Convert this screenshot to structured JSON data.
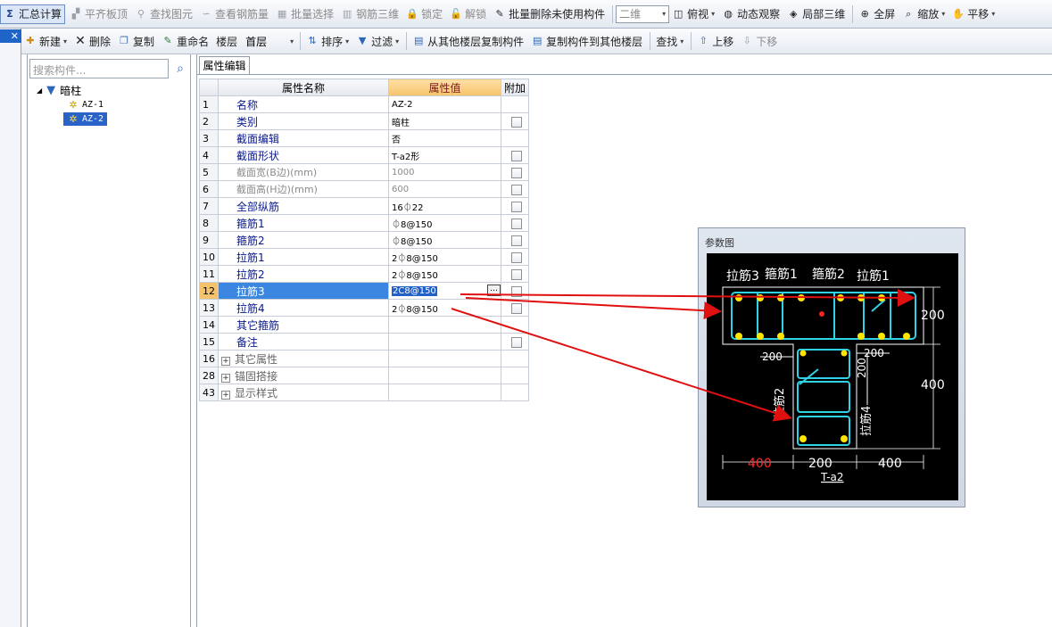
{
  "toolbar1": [
    {
      "id": "summary",
      "label": "汇总计算",
      "icon": "sigma-icon",
      "glyph": "Σ",
      "selected": true,
      "disabled": false
    },
    {
      "id": "flush",
      "label": "平齐板顶",
      "icon": "flush-icon",
      "glyph": "▞",
      "disabled": true
    },
    {
      "id": "find",
      "label": "查找图元",
      "icon": "binoculars-icon",
      "glyph": "⚲",
      "disabled": true
    },
    {
      "id": "rebar",
      "label": "查看钢筋量",
      "icon": "rebar-icon",
      "glyph": "∽",
      "disabled": true
    },
    {
      "id": "batch",
      "label": "批量选择",
      "icon": "batch-select-icon",
      "glyph": "▦",
      "disabled": true
    },
    {
      "id": "r3d",
      "label": "钢筋三维",
      "icon": "rebar-3d-icon",
      "glyph": "▥",
      "disabled": true
    },
    {
      "id": "lock",
      "label": "锁定",
      "icon": "lock-icon",
      "glyph": "🔒",
      "disabled": true
    },
    {
      "id": "unlock",
      "label": "解锁",
      "icon": "unlock-icon",
      "glyph": "🔓",
      "disabled": true
    },
    {
      "id": "batchdel",
      "label": "批量删除未使用构件",
      "icon": "brush-icon",
      "glyph": "✎",
      "disabled": false
    }
  ],
  "toolbar1_right": [
    {
      "id": "top",
      "label": "俯视",
      "icon": "top-view-icon",
      "glyph": "◫",
      "arrow": true
    },
    {
      "id": "orbit",
      "label": "动态观察",
      "icon": "orbit-icon",
      "glyph": "◍",
      "arrow": false
    },
    {
      "id": "local3d",
      "label": "局部三维",
      "icon": "local-3d-icon",
      "glyph": "◈",
      "arrow": false
    },
    {
      "id": "full",
      "label": "全屏",
      "icon": "fullscreen-icon",
      "glyph": "⊕",
      "arrow": false
    },
    {
      "id": "zoom",
      "label": "缩放",
      "icon": "zoom-icon",
      "glyph": "⌕",
      "arrow": true
    },
    {
      "id": "pan",
      "label": "平移",
      "icon": "pan-icon",
      "glyph": "✋",
      "arrow": true
    }
  ],
  "view_combo": "二维",
  "toolbar2": {
    "new": "新建",
    "delete": "删除",
    "copy": "复制",
    "rename": "重命名",
    "floor_label": "楼层",
    "floor_value": "首层",
    "sort": "排序",
    "filter": "过滤",
    "copy_from": "从其他楼层复制构件",
    "copy_to": "复制构件到其他楼层",
    "find": "查找",
    "up": "上移",
    "down": "下移"
  },
  "search_placeholder": "搜索构件...",
  "tree": {
    "root": "暗柱",
    "items": [
      "AZ-1",
      "AZ-2"
    ],
    "selected": 1
  },
  "props": {
    "tab": "属性编辑",
    "headers": {
      "name": "属性名称",
      "value": "属性值",
      "extra": "附加"
    },
    "rows": [
      {
        "n": "1",
        "name": "名称",
        "value": "AZ-2",
        "cb": false,
        "style": "nm"
      },
      {
        "n": "2",
        "name": "类别",
        "value": "暗柱",
        "cb": true,
        "style": "nm"
      },
      {
        "n": "3",
        "name": "截面编辑",
        "value": "否",
        "cb": false,
        "style": "nm"
      },
      {
        "n": "4",
        "name": "截面形状",
        "value": "T-a2形",
        "cb": true,
        "style": "nm"
      },
      {
        "n": "5",
        "name": "截面宽(B边)(mm)",
        "value": "1000",
        "cb": true,
        "style": "gr"
      },
      {
        "n": "6",
        "name": "截面高(H边)(mm)",
        "value": "600",
        "cb": true,
        "style": "gr"
      },
      {
        "n": "7",
        "name": "全部纵筋",
        "value": "16⏀22",
        "cb": true,
        "style": "nm"
      },
      {
        "n": "8",
        "name": "箍筋1",
        "value": "⏀8@150",
        "cb": true,
        "style": "nm"
      },
      {
        "n": "9",
        "name": "箍筋2",
        "value": "⏀8@150",
        "cb": true,
        "style": "nm"
      },
      {
        "n": "10",
        "name": "拉筋1",
        "value": "2⏀8@150",
        "cb": true,
        "style": "nm"
      },
      {
        "n": "11",
        "name": "拉筋2",
        "value": "2⏀8@150",
        "cb": true,
        "style": "nm"
      },
      {
        "n": "12",
        "name": "拉筋3",
        "value": "2C8@150",
        "cb": true,
        "style": "nm",
        "selected": true
      },
      {
        "n": "13",
        "name": "拉筋4",
        "value": "2⏀8@150",
        "cb": true,
        "style": "nm"
      },
      {
        "n": "14",
        "name": "其它箍筋",
        "value": "",
        "cb": false,
        "style": "nm"
      },
      {
        "n": "15",
        "name": "备注",
        "value": "",
        "cb": true,
        "style": "nm"
      },
      {
        "n": "16",
        "name": "其它属性",
        "value": "",
        "cb": false,
        "style": "grp"
      },
      {
        "n": "28",
        "name": "锚固搭接",
        "value": "",
        "cb": false,
        "style": "grp"
      },
      {
        "n": "43",
        "name": "显示样式",
        "value": "",
        "cb": false,
        "style": "grp"
      }
    ]
  },
  "param": {
    "title": "参数图",
    "labels": {
      "l3": "拉筋3",
      "g1": "箍筋1",
      "g2": "箍筋2",
      "l1": "拉筋1",
      "l2": "拉筋2",
      "l4": "拉筋4"
    },
    "dims": {
      "top_h": "200",
      "stem_h": "400",
      "w_left": "200",
      "w_right": "200",
      "stem_w": "200",
      "stem_seg": "200",
      "bot_left": "400",
      "bot_mid": "200",
      "bot_right": "400"
    },
    "shape": "T-a2"
  }
}
